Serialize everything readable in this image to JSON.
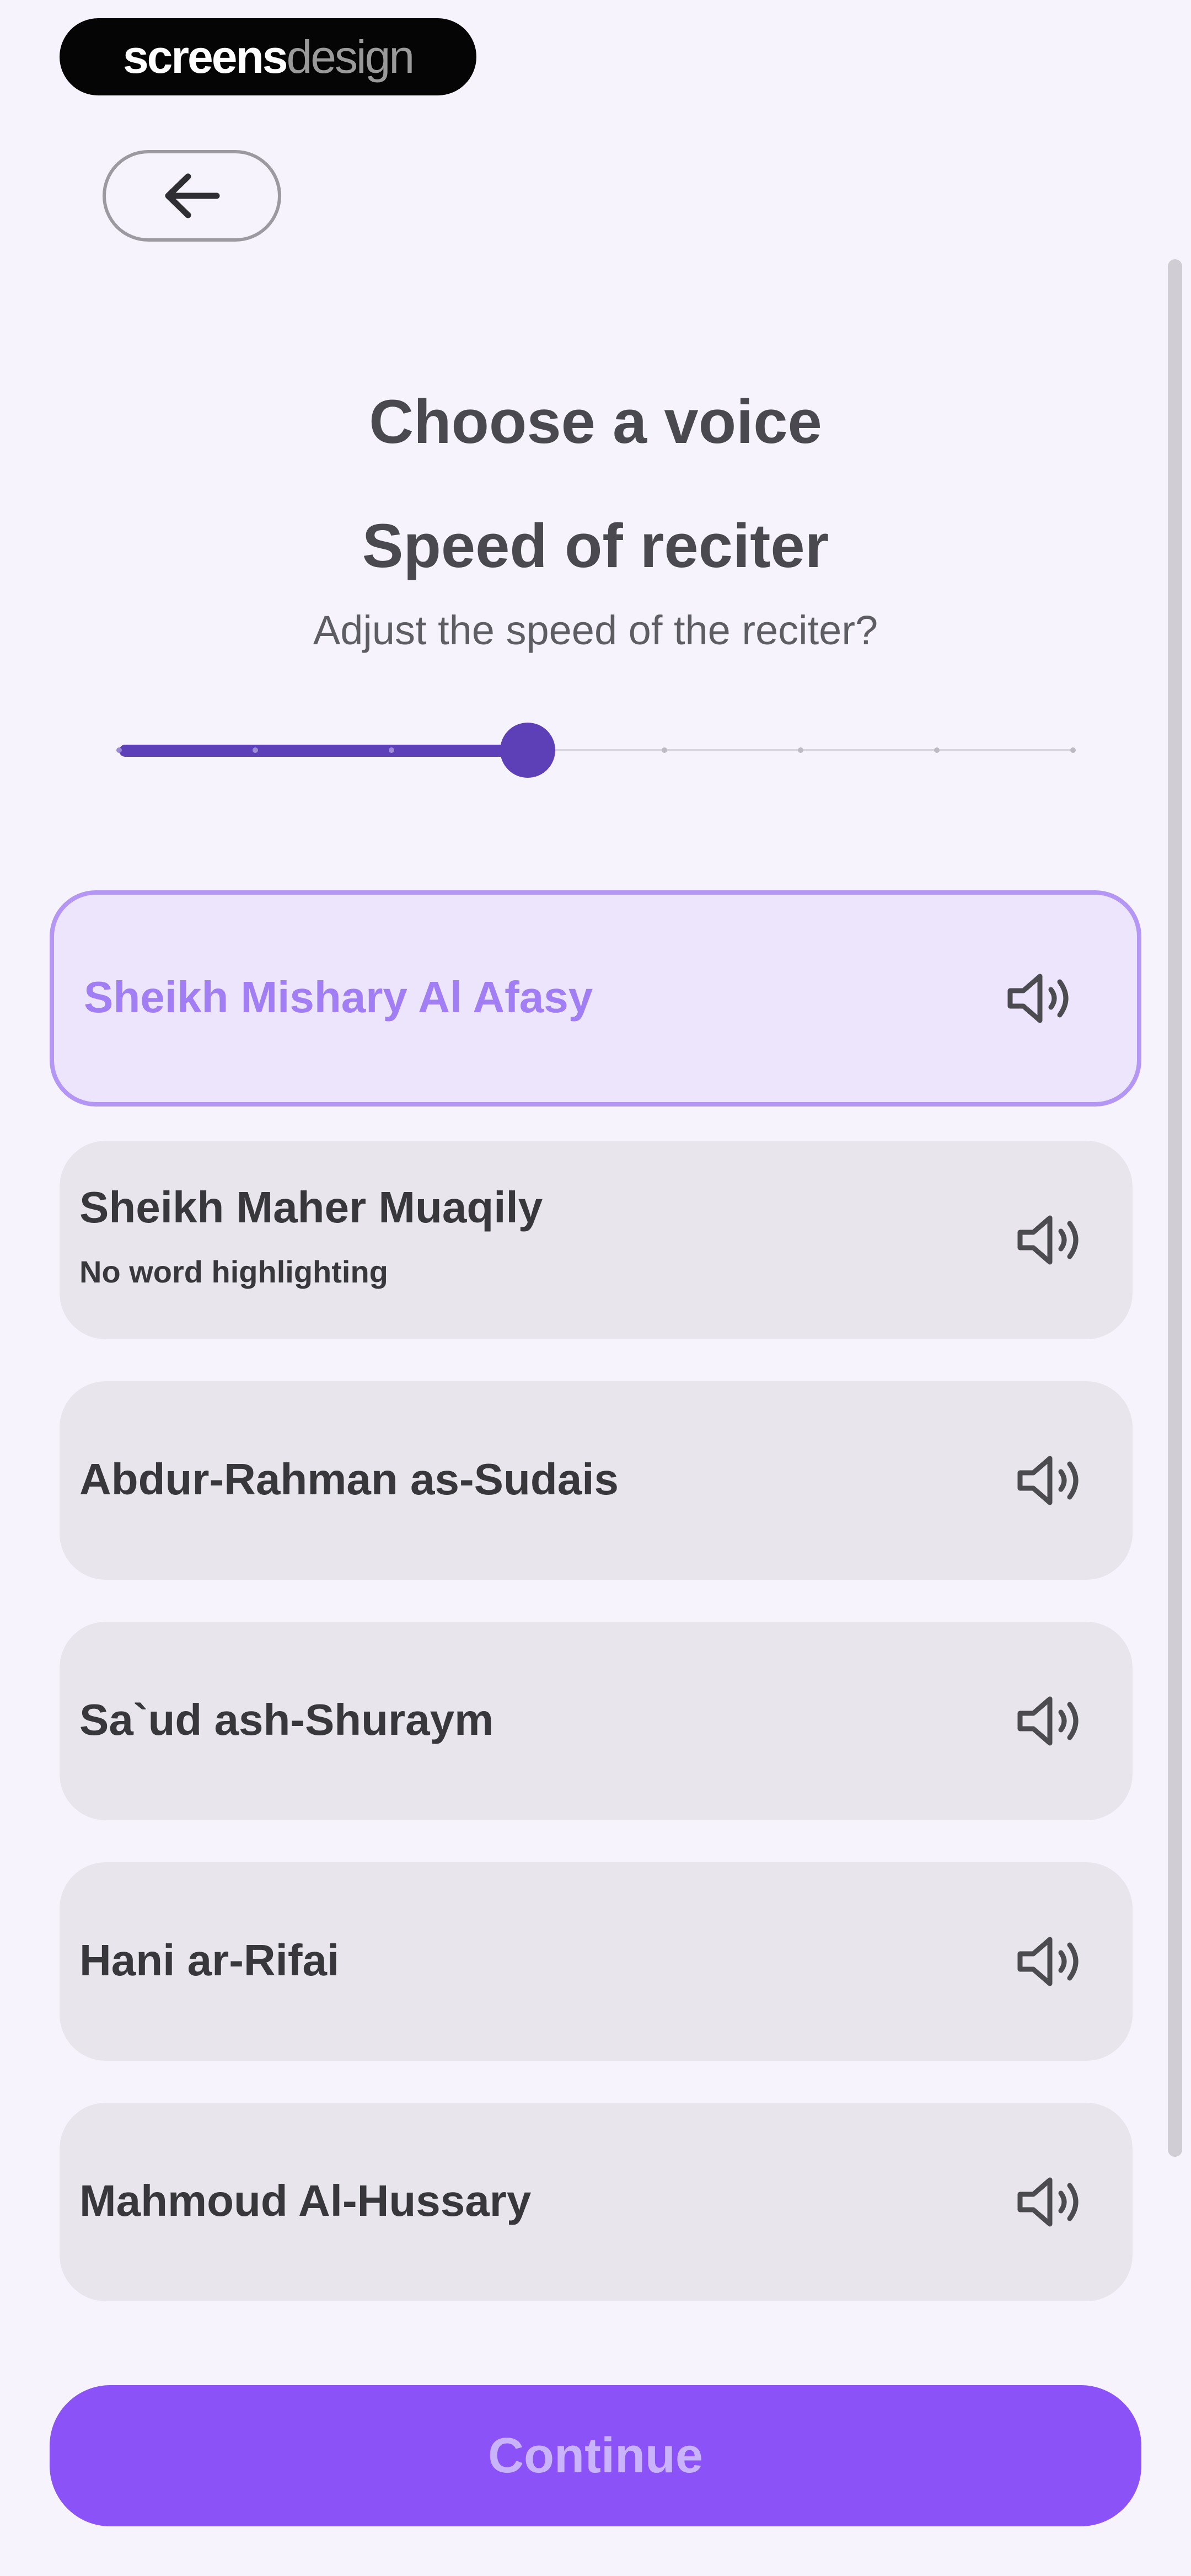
{
  "watermark": {
    "part_bold": "screens",
    "part_light": "design"
  },
  "header": {
    "back_icon": "arrow-left-icon"
  },
  "titles": {
    "choose_voice": "Choose a voice",
    "speed_heading": "Speed of reciter",
    "speed_question": "Adjust the speed of the reciter?"
  },
  "speed_slider": {
    "steps": 8,
    "selected_step": 3
  },
  "reciters": [
    {
      "name": "Sheikh Mishary Al Afasy",
      "note": "",
      "selected": true,
      "icon": "speaker-icon"
    },
    {
      "name": "Sheikh Maher Muaqily",
      "note": "No word highlighting",
      "selected": false,
      "icon": "speaker-icon"
    },
    {
      "name": "Abdur-Rahman as-Sudais",
      "note": "",
      "selected": false,
      "icon": "speaker-icon"
    },
    {
      "name": "Sa`ud ash-Shuraym",
      "note": "",
      "selected": false,
      "icon": "speaker-icon"
    },
    {
      "name": "Hani ar-Rifai",
      "note": "",
      "selected": false,
      "icon": "speaker-icon"
    },
    {
      "name": "Mahmoud Al-Hussary",
      "note": "",
      "selected": false,
      "icon": "speaker-icon"
    }
  ],
  "continue_label": "Continue",
  "colors": {
    "accent": "#8b52f8",
    "slider": "#5d3fb8",
    "selected_text": "#a17ef3",
    "selected_border": "#b496f5",
    "card_bg": "#e8e6ec"
  }
}
